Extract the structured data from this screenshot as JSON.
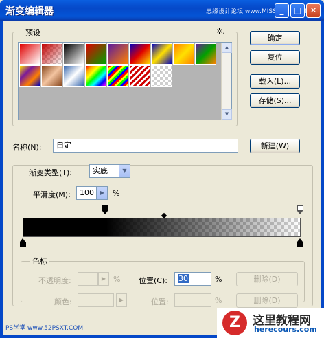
{
  "window": {
    "title": "渐变编辑器",
    "watermark": "思缘设计论坛 www.MISSYUAN.COM",
    "minimize_label": "_",
    "maximize_label": "□",
    "close_label": "✕"
  },
  "presets": {
    "label": "预设",
    "menu_icon": "gear-icon",
    "menu_glyph": "✲.",
    "swatch_names": [
      "red-to-transparent",
      "black-red-transparent",
      "black-white",
      "red-to-green",
      "violet-orange",
      "blue-red-yellow",
      "blue-yellow-blue",
      "orange-yellow-orange",
      "violet-green-orange",
      "yellow-violet-orange-blue",
      "copper",
      "chrome",
      "spectrum",
      "transparent-rainbow",
      "transparent-stripes",
      "neutral-density"
    ]
  },
  "buttons": {
    "ok": "确定",
    "reset": "复位",
    "load": "载入(L)...",
    "save": "存储(S)...",
    "new": "新建(W)"
  },
  "name_field": {
    "label": "名称(N):",
    "value": "自定"
  },
  "gradient_type": {
    "label": "渐变类型(T):",
    "value": "实底"
  },
  "smoothness": {
    "label": "平滑度(M):",
    "value": "100",
    "unit": "%"
  },
  "gradient": {
    "opaque_until_fraction": 0.3,
    "midpoint_fraction": 0.5
  },
  "color_stops": {
    "group_label": "色标",
    "opacity_label": "不透明度:",
    "opacity_unit": "%",
    "opacity_location_label": "位置(C):",
    "opacity_location_value": "30",
    "opacity_location_unit": "%",
    "delete_label_1": "删除(D)",
    "color_label": "颜色:",
    "color_location_label": "位置:",
    "color_location_unit": "%",
    "delete_label_2": "删除(D)"
  },
  "footer": {
    "site_mark": "PS学堂 www.52PSXT.COM",
    "logo_glyph": "Z",
    "logo_title": "这里教程网",
    "logo_url": "herecours.com"
  },
  "colors": {
    "titlebar": "#0548c8",
    "dialog_bg": "#ece9d8",
    "logo_red": "#d62b2b"
  }
}
